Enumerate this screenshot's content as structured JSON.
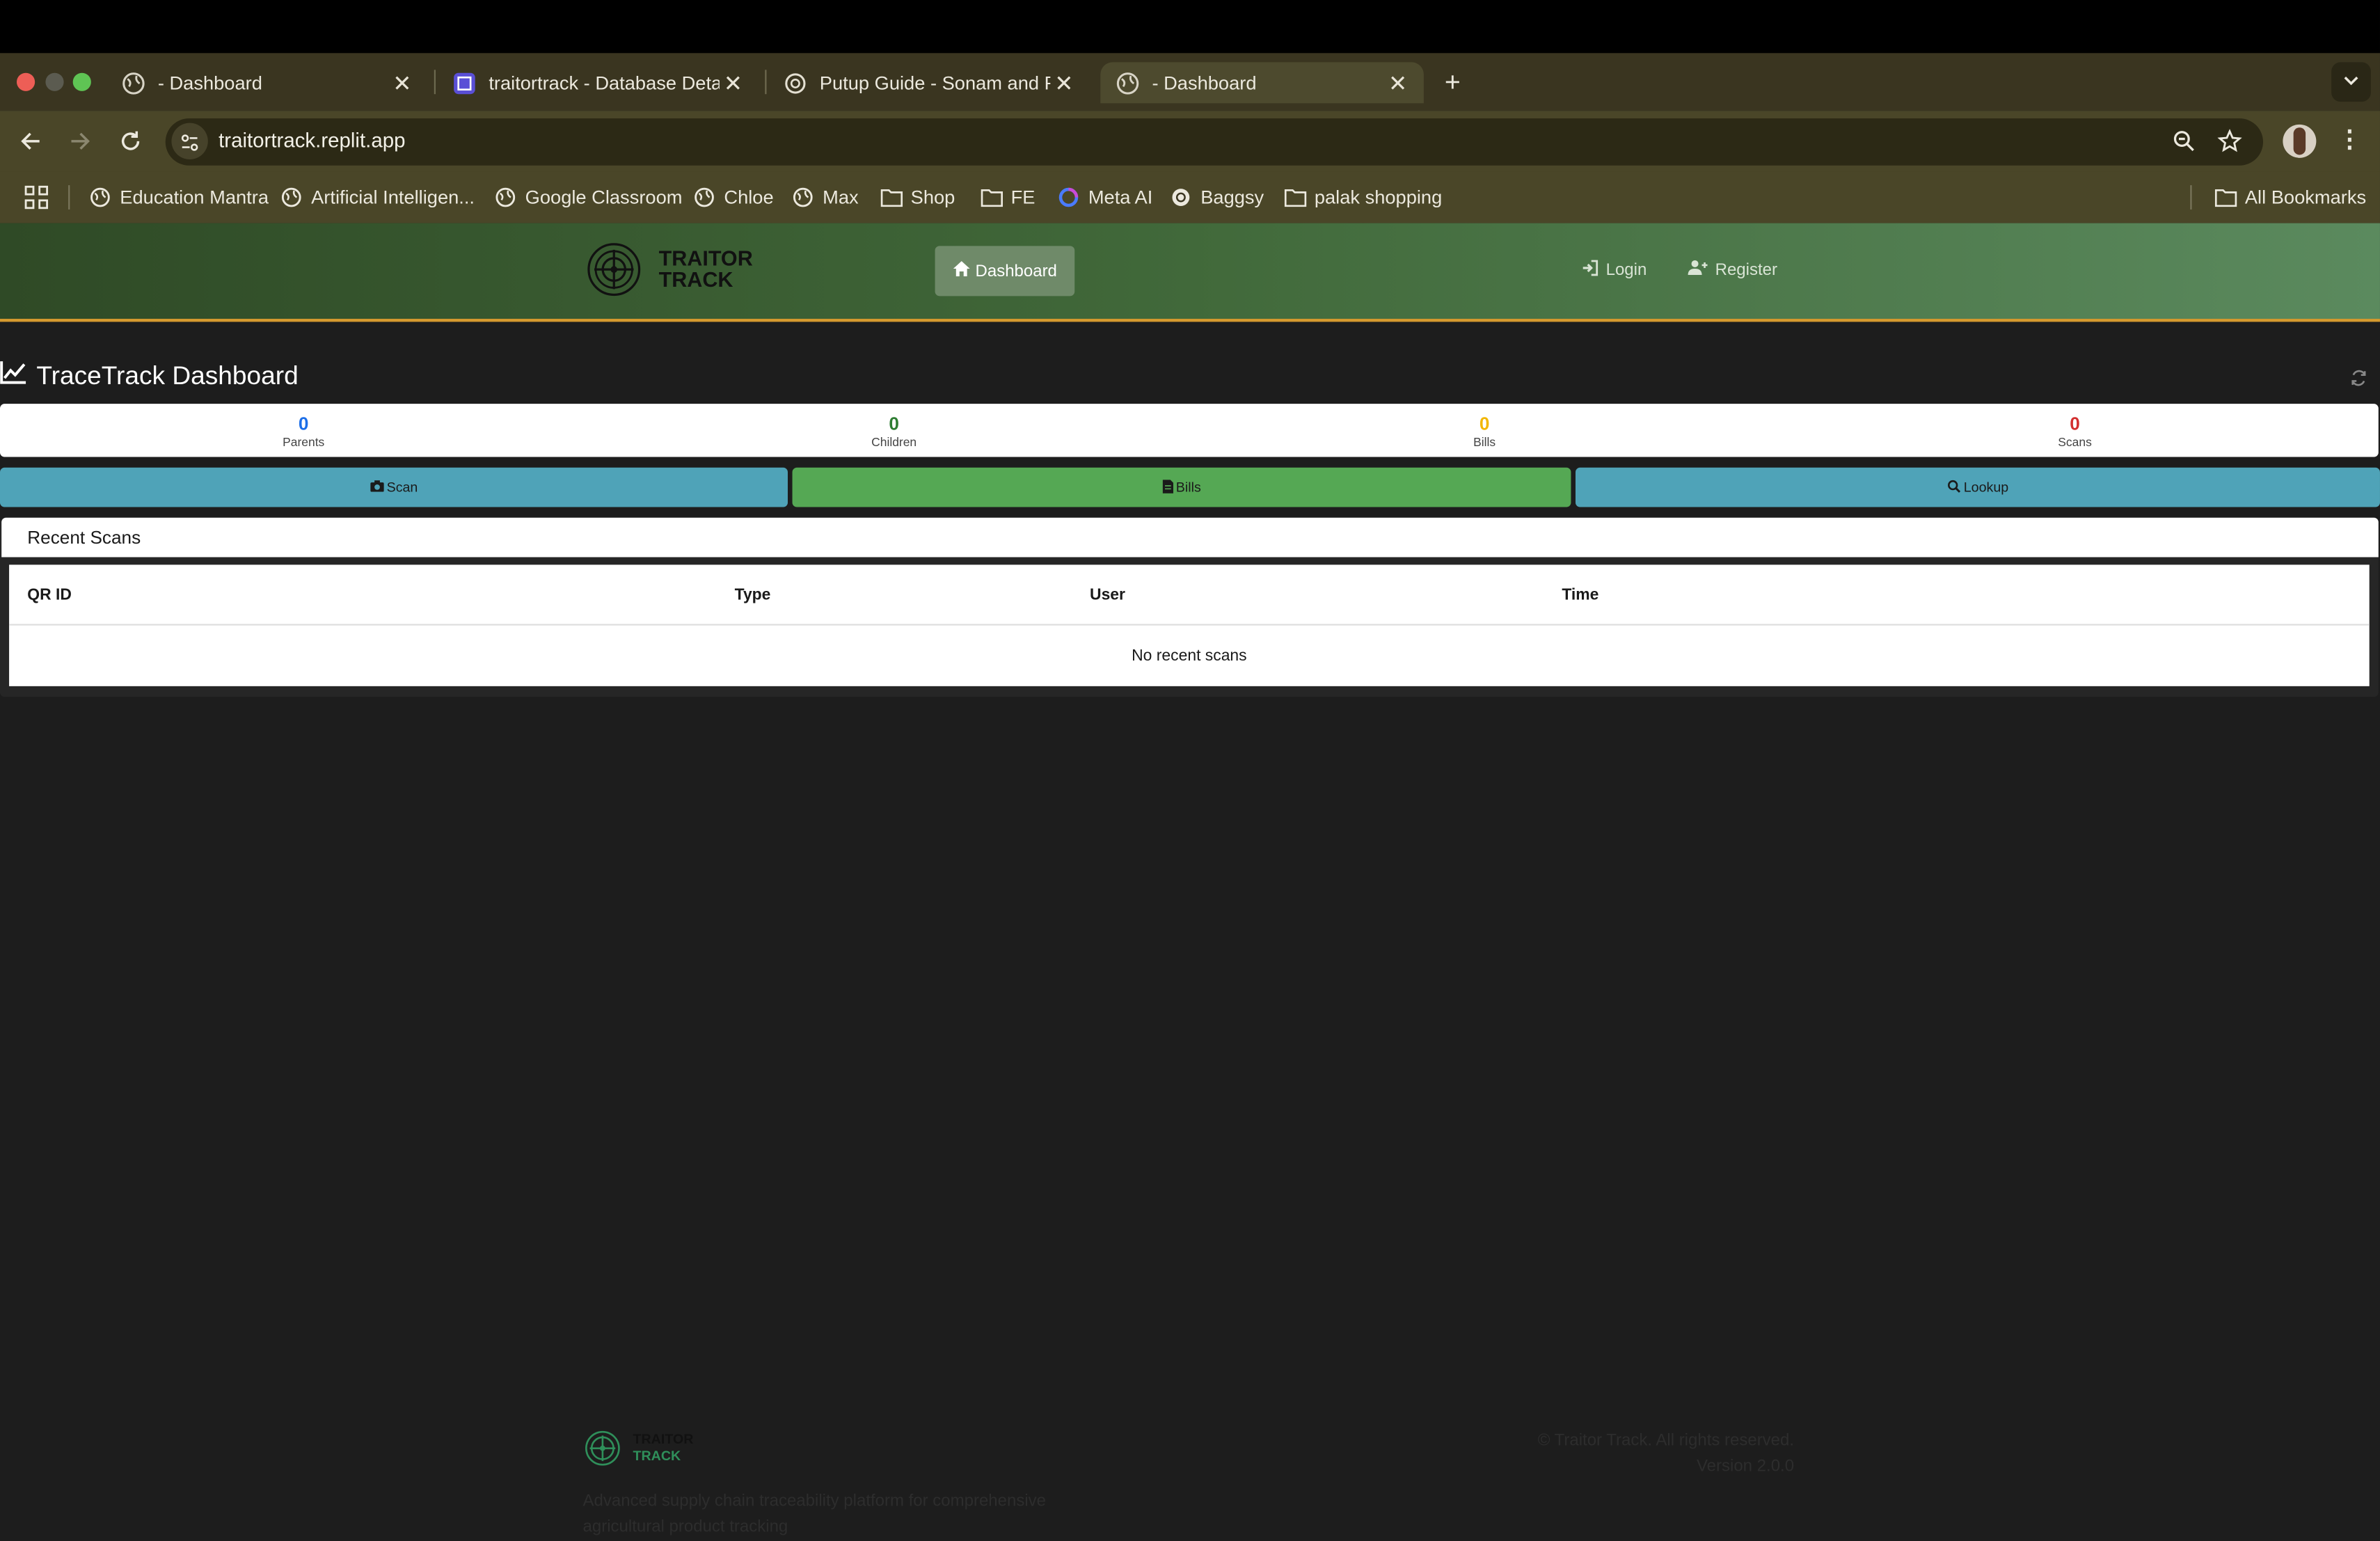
{
  "browser": {
    "tabs": [
      {
        "label": "- Dashboard",
        "icon": "globe-icon",
        "active": false
      },
      {
        "label": "traitortrack - Database Details",
        "icon": "replit-db-icon",
        "active": false
      },
      {
        "label": "Putup Guide - Sonam and Rhea",
        "icon": "openai-icon",
        "active": false
      },
      {
        "label": "- Dashboard",
        "icon": "globe-icon",
        "active": true
      }
    ],
    "url": "traitortrack.replit.app",
    "bookmarks": [
      {
        "label": "Education Mantra",
        "icon": "globe-icon"
      },
      {
        "label": "Artificial Intelligen...",
        "icon": "globe-icon"
      },
      {
        "label": "Google Classroom",
        "icon": "globe-icon"
      },
      {
        "label": "Chloe",
        "icon": "globe-icon"
      },
      {
        "label": "Max",
        "icon": "globe-icon"
      },
      {
        "label": "Shop",
        "icon": "folder-icon"
      },
      {
        "label": "FE",
        "icon": "folder-icon"
      },
      {
        "label": "Meta AI",
        "icon": "meta-ai-icon"
      },
      {
        "label": "Baggsy",
        "icon": "openai-icon"
      },
      {
        "label": "palak shopping",
        "icon": "folder-icon"
      }
    ],
    "all_bookmarks": "All Bookmarks"
  },
  "app": {
    "brand_line1": "TRAITOR",
    "brand_line2": "TRACK",
    "nav": {
      "dashboard": "Dashboard",
      "login": "Login",
      "register": "Register"
    },
    "page_title": "TraceTrack Dashboard",
    "stats": [
      {
        "value": "0",
        "label": "Parents",
        "color": "#1d6fe8"
      },
      {
        "value": "0",
        "label": "Children",
        "color": "#2e7d32"
      },
      {
        "value": "0",
        "label": "Bills",
        "color": "#f2b705"
      },
      {
        "value": "0",
        "label": "Scans",
        "color": "#d32f2f"
      }
    ],
    "actions": [
      {
        "label": "Scan",
        "color": "#4fa3b8"
      },
      {
        "label": "Bills",
        "color": "#55a854"
      },
      {
        "label": "Lookup",
        "color": "#4fa3b8"
      }
    ],
    "recent_scans": {
      "title": "Recent Scans",
      "columns": [
        "QR ID",
        "Type",
        "User",
        "Time"
      ],
      "empty_text": "No recent scans"
    },
    "footer": {
      "brand_line1": "TRAITOR",
      "brand_line2": "TRACK",
      "description": "Advanced supply chain traceability platform for comprehensive agricultural product tracking",
      "copyright": "© Traitor Track. All rights reserved.",
      "version": "Version 2.0.0"
    }
  }
}
